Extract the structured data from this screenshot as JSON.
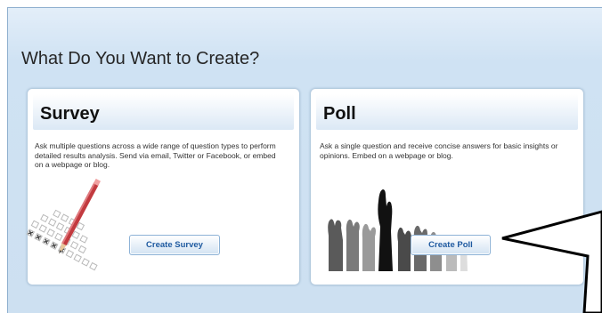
{
  "page": {
    "title": "What Do You Want to Create?"
  },
  "survey_card": {
    "title": "Survey",
    "description": "Ask multiple questions across a wide range of question types to perform detailed results analysis. Send via email, Twitter or Facebook, or embed on a webpage or blog.",
    "button_label": "Create Survey",
    "illustration_icon": "checklist-pencil-icon"
  },
  "poll_card": {
    "title": "Poll",
    "description": "Ask a single question and receive concise answers for basic insights or opinions. Embed on a webpage or blog.",
    "button_label": "Create Poll",
    "illustration_icon": "raised-hands-icon"
  },
  "annotation": {
    "icon": "callout-arrow-icon"
  },
  "colors": {
    "panel_background": "#cfe2f3",
    "button_text": "#1f5aa0",
    "button_border": "#8db2d6"
  }
}
